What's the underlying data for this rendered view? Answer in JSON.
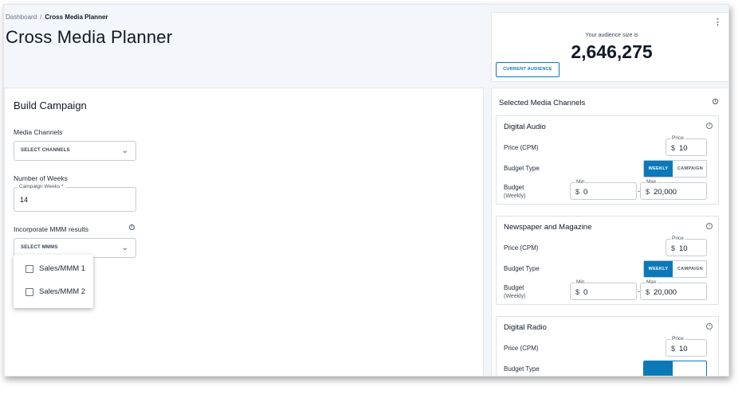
{
  "breadcrumb": {
    "root": "Dashboard",
    "separator": "/",
    "current": "Cross Media Planner"
  },
  "page_title": "Cross Media Planner",
  "audience": {
    "label": "Your audience size is",
    "value": "2,646,275",
    "button": "CURRENT AUDIENCE",
    "menu_icon": "kebab-menu-icon"
  },
  "build": {
    "title": "Build Campaign",
    "media_channels": {
      "label": "Media Channels",
      "placeholder": "SELECT CHANNELS"
    },
    "weeks": {
      "label": "Number of Weeks",
      "legend": "Campaign Weeks *",
      "value": "14"
    },
    "mmm": {
      "label": "Incorporate MMM results",
      "placeholder": "SELECT MMMS",
      "options": [
        "Sales/MMM 1",
        "Sales/MMM 2"
      ]
    }
  },
  "channels_panel": {
    "title": "Selected Media Channels",
    "channels": [
      {
        "name": "Digital Audio",
        "price_label": "Price (CPM)",
        "price_legend": "Price",
        "price": "10",
        "budget_type_label": "Budget Type",
        "weekly": "WEEKLY",
        "campaign": "CAMPAIGN",
        "budget_label": "Budget",
        "budget_sub": "(Weekly)",
        "min_legend": "Min",
        "min": "0",
        "max_legend": "Max",
        "max": "20,000",
        "currency": "$",
        "dash": "-"
      },
      {
        "name": "Newspaper and Magazine",
        "price_label": "Price (CPM)",
        "price_legend": "Price",
        "price": "10",
        "budget_type_label": "Budget Type",
        "weekly": "WEEKLY",
        "campaign": "CAMPAIGN",
        "budget_label": "Budget",
        "budget_sub": "(Weekly)",
        "min_legend": "Min",
        "min": "0",
        "max_legend": "Max",
        "max": "20,000",
        "currency": "$",
        "dash": "-"
      },
      {
        "name": "Digital Radio",
        "price_label": "Price (CPM)",
        "price_legend": "Price",
        "price": "10",
        "budget_type_label": "Budget Type",
        "currency": "$"
      }
    ]
  },
  "colors": {
    "accent": "#0b79b8",
    "background": "#f3f6f9",
    "card": "#ffffff"
  }
}
